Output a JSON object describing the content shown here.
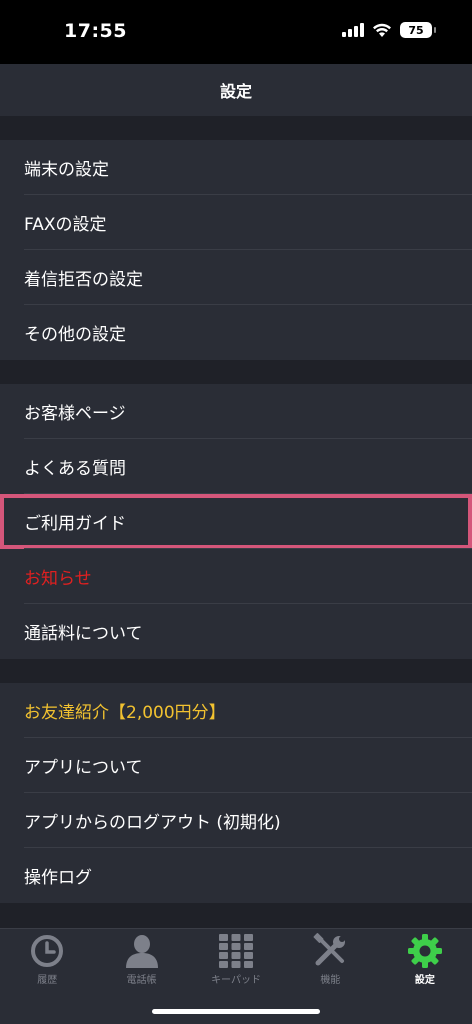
{
  "status": {
    "time": "17:55",
    "battery": "75"
  },
  "header": {
    "title": "設定"
  },
  "groups": [
    {
      "items": [
        "端末の設定",
        "FAXの設定",
        "着信拒否の設定",
        "その他の設定"
      ]
    },
    {
      "items": [
        "お客様ページ",
        "よくある質問",
        "ご利用ガイド",
        "お知らせ",
        "通話料について"
      ]
    },
    {
      "items": [
        "お友達紹介【2,000円分】",
        "アプリについて",
        "アプリからのログアウト (初期化)",
        "操作ログ"
      ]
    }
  ],
  "colors": {
    "red_item": "#e02020",
    "promo_item": "#f2c230",
    "highlight": "#d4567a",
    "active_tab": "#3ecf4a"
  },
  "tabs": [
    {
      "label": "履歴",
      "icon": "clock-icon"
    },
    {
      "label": "電話帳",
      "icon": "person-icon"
    },
    {
      "label": "キーパッド",
      "icon": "keypad-icon"
    },
    {
      "label": "機能",
      "icon": "tools-icon"
    },
    {
      "label": "設定",
      "icon": "gear-icon",
      "active": true
    }
  ]
}
